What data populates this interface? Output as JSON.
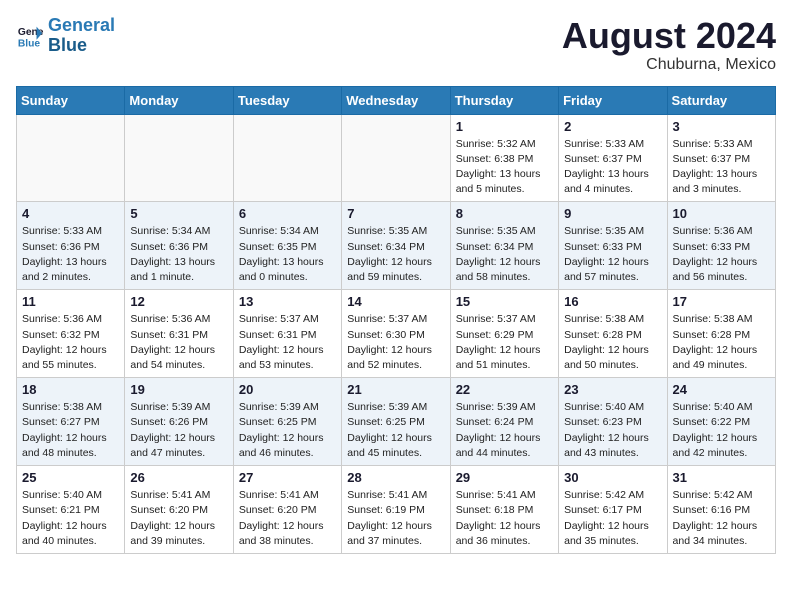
{
  "header": {
    "logo_general": "General",
    "logo_blue": "Blue",
    "month_year": "August 2024",
    "location": "Chuburna, Mexico"
  },
  "days_of_week": [
    "Sunday",
    "Monday",
    "Tuesday",
    "Wednesday",
    "Thursday",
    "Friday",
    "Saturday"
  ],
  "weeks": [
    [
      {
        "day": "",
        "info": ""
      },
      {
        "day": "",
        "info": ""
      },
      {
        "day": "",
        "info": ""
      },
      {
        "day": "",
        "info": ""
      },
      {
        "day": "1",
        "info": "Sunrise: 5:32 AM\nSunset: 6:38 PM\nDaylight: 13 hours\nand 5 minutes."
      },
      {
        "day": "2",
        "info": "Sunrise: 5:33 AM\nSunset: 6:37 PM\nDaylight: 13 hours\nand 4 minutes."
      },
      {
        "day": "3",
        "info": "Sunrise: 5:33 AM\nSunset: 6:37 PM\nDaylight: 13 hours\nand 3 minutes."
      }
    ],
    [
      {
        "day": "4",
        "info": "Sunrise: 5:33 AM\nSunset: 6:36 PM\nDaylight: 13 hours\nand 2 minutes."
      },
      {
        "day": "5",
        "info": "Sunrise: 5:34 AM\nSunset: 6:36 PM\nDaylight: 13 hours\nand 1 minute."
      },
      {
        "day": "6",
        "info": "Sunrise: 5:34 AM\nSunset: 6:35 PM\nDaylight: 13 hours\nand 0 minutes."
      },
      {
        "day": "7",
        "info": "Sunrise: 5:35 AM\nSunset: 6:34 PM\nDaylight: 12 hours\nand 59 minutes."
      },
      {
        "day": "8",
        "info": "Sunrise: 5:35 AM\nSunset: 6:34 PM\nDaylight: 12 hours\nand 58 minutes."
      },
      {
        "day": "9",
        "info": "Sunrise: 5:35 AM\nSunset: 6:33 PM\nDaylight: 12 hours\nand 57 minutes."
      },
      {
        "day": "10",
        "info": "Sunrise: 5:36 AM\nSunset: 6:33 PM\nDaylight: 12 hours\nand 56 minutes."
      }
    ],
    [
      {
        "day": "11",
        "info": "Sunrise: 5:36 AM\nSunset: 6:32 PM\nDaylight: 12 hours\nand 55 minutes."
      },
      {
        "day": "12",
        "info": "Sunrise: 5:36 AM\nSunset: 6:31 PM\nDaylight: 12 hours\nand 54 minutes."
      },
      {
        "day": "13",
        "info": "Sunrise: 5:37 AM\nSunset: 6:31 PM\nDaylight: 12 hours\nand 53 minutes."
      },
      {
        "day": "14",
        "info": "Sunrise: 5:37 AM\nSunset: 6:30 PM\nDaylight: 12 hours\nand 52 minutes."
      },
      {
        "day": "15",
        "info": "Sunrise: 5:37 AM\nSunset: 6:29 PM\nDaylight: 12 hours\nand 51 minutes."
      },
      {
        "day": "16",
        "info": "Sunrise: 5:38 AM\nSunset: 6:28 PM\nDaylight: 12 hours\nand 50 minutes."
      },
      {
        "day": "17",
        "info": "Sunrise: 5:38 AM\nSunset: 6:28 PM\nDaylight: 12 hours\nand 49 minutes."
      }
    ],
    [
      {
        "day": "18",
        "info": "Sunrise: 5:38 AM\nSunset: 6:27 PM\nDaylight: 12 hours\nand 48 minutes."
      },
      {
        "day": "19",
        "info": "Sunrise: 5:39 AM\nSunset: 6:26 PM\nDaylight: 12 hours\nand 47 minutes."
      },
      {
        "day": "20",
        "info": "Sunrise: 5:39 AM\nSunset: 6:25 PM\nDaylight: 12 hours\nand 46 minutes."
      },
      {
        "day": "21",
        "info": "Sunrise: 5:39 AM\nSunset: 6:25 PM\nDaylight: 12 hours\nand 45 minutes."
      },
      {
        "day": "22",
        "info": "Sunrise: 5:39 AM\nSunset: 6:24 PM\nDaylight: 12 hours\nand 44 minutes."
      },
      {
        "day": "23",
        "info": "Sunrise: 5:40 AM\nSunset: 6:23 PM\nDaylight: 12 hours\nand 43 minutes."
      },
      {
        "day": "24",
        "info": "Sunrise: 5:40 AM\nSunset: 6:22 PM\nDaylight: 12 hours\nand 42 minutes."
      }
    ],
    [
      {
        "day": "25",
        "info": "Sunrise: 5:40 AM\nSunset: 6:21 PM\nDaylight: 12 hours\nand 40 minutes."
      },
      {
        "day": "26",
        "info": "Sunrise: 5:41 AM\nSunset: 6:20 PM\nDaylight: 12 hours\nand 39 minutes."
      },
      {
        "day": "27",
        "info": "Sunrise: 5:41 AM\nSunset: 6:20 PM\nDaylight: 12 hours\nand 38 minutes."
      },
      {
        "day": "28",
        "info": "Sunrise: 5:41 AM\nSunset: 6:19 PM\nDaylight: 12 hours\nand 37 minutes."
      },
      {
        "day": "29",
        "info": "Sunrise: 5:41 AM\nSunset: 6:18 PM\nDaylight: 12 hours\nand 36 minutes."
      },
      {
        "day": "30",
        "info": "Sunrise: 5:42 AM\nSunset: 6:17 PM\nDaylight: 12 hours\nand 35 minutes."
      },
      {
        "day": "31",
        "info": "Sunrise: 5:42 AM\nSunset: 6:16 PM\nDaylight: 12 hours\nand 34 minutes."
      }
    ]
  ]
}
